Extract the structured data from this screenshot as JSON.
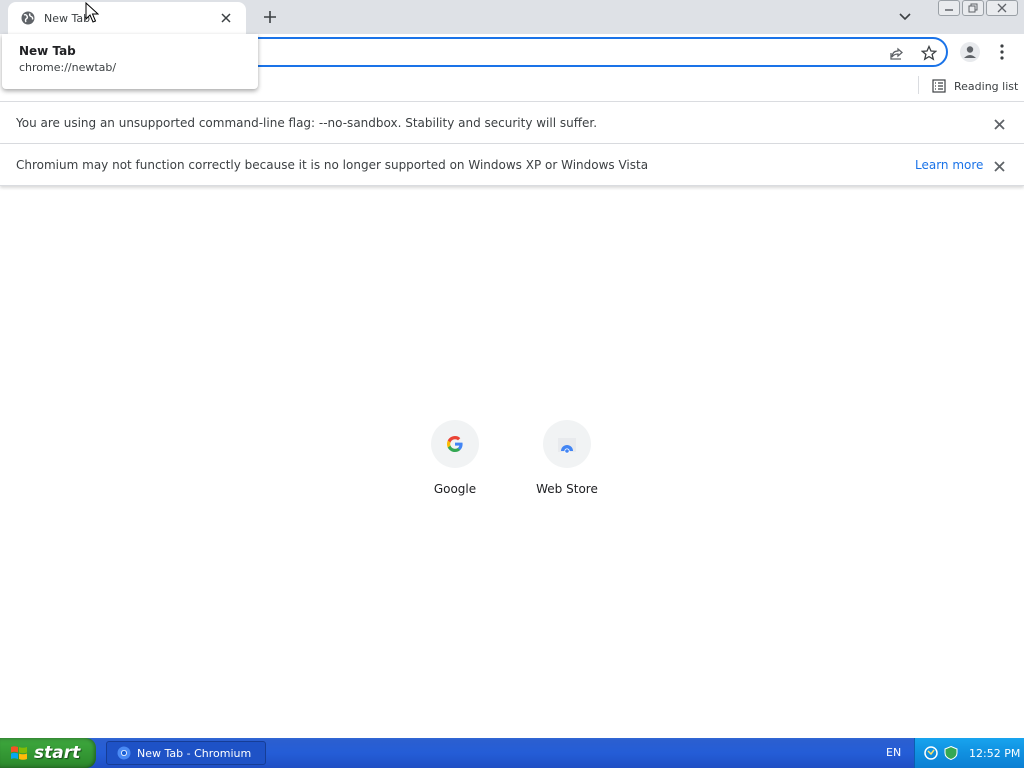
{
  "browser": {
    "tab": {
      "title": "New Tab",
      "favicon": "globe-icon"
    },
    "hovercard": {
      "title": "New Tab",
      "url": "chrome://newtab/"
    },
    "bookmarks": {
      "reading_list_label": "Reading list"
    }
  },
  "infobars": [
    {
      "text": "You are using an unsupported command-line flag: --no-sandbox. Stability and security will suffer."
    },
    {
      "text": "Chromium may not function correctly because it is no longer supported on Windows XP or Windows Vista",
      "link": "Learn more"
    }
  ],
  "ntp": {
    "shortcuts": [
      {
        "label": "Google",
        "icon": "google-icon"
      },
      {
        "label": "Web Store",
        "icon": "web-store-icon"
      }
    ]
  },
  "taskbar": {
    "start_label": "start",
    "task_item_label": "New Tab - Chromium",
    "language": "EN",
    "clock": "12:52 PM"
  },
  "colors": {
    "accent": "#1a73e8",
    "tabstrip": "#dee1e6",
    "taskbar": "#245dd7",
    "start": "#3aa33a"
  }
}
